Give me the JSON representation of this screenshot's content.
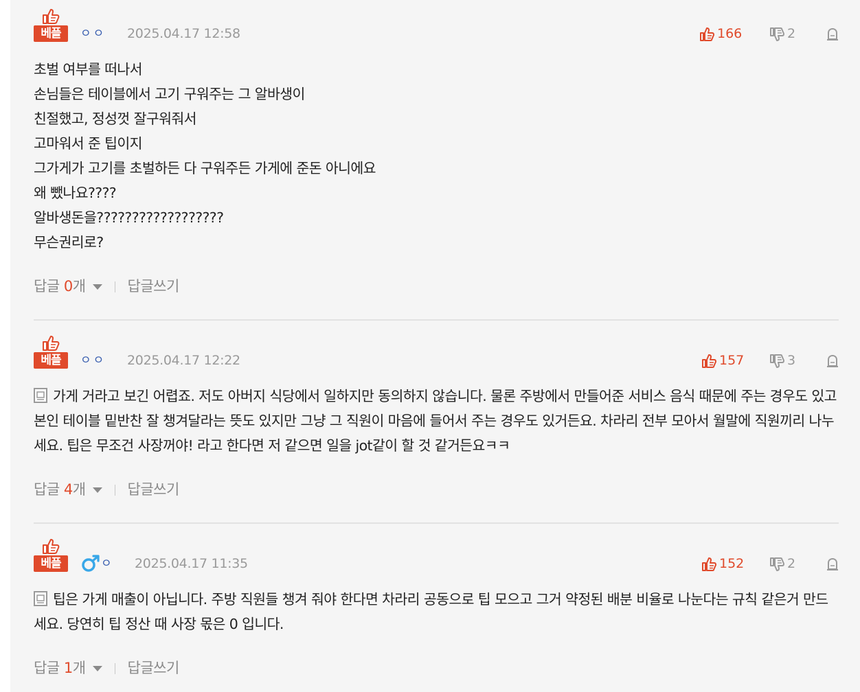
{
  "colors": {
    "accent": "#e04a2b",
    "muted": "#9a9a9a",
    "nick": "#3a5fb0",
    "panel": "#f5f5f5"
  },
  "labels": {
    "reply": "답글",
    "reply_unit": "개",
    "write_reply": "답글쓰기"
  },
  "comments": [
    {
      "badge": "베플",
      "nick": "ㅇㅇ",
      "gender_icon": "",
      "timestamp": "2025.04.17 12:58",
      "upvotes": "166",
      "downvotes": "2",
      "has_memo_icon": false,
      "text": "초벌 여부를 떠나서\n손님들은 테이블에서 고기 구워주는 그 알바생이\n친절했고, 정성껏 잘구워줘서\n고마워서 준 팁이지\n그가게가 고기를 초벌하든 다 구워주든 가게에 준돈 아니에요\n왜 뺐나요????\n알바생돈을??????????????????\n무슨권리로?",
      "reply_count": "0"
    },
    {
      "badge": "베플",
      "nick": "ㅇㅇ",
      "gender_icon": "",
      "timestamp": "2025.04.17 12:22",
      "upvotes": "157",
      "downvotes": "3",
      "has_memo_icon": true,
      "text": "가게 거라고 보긴 어렵죠. 저도 아버지 식당에서 일하지만 동의하지 않습니다. 물론 주방에서 만들어준 서비스 음식 때문에 주는 경우도 있고 본인 테이블 밑반찬 잘 챙겨달라는 뜻도 있지만 그냥 그 직원이 마음에 들어서 주는 경우도 있거든요. 차라리 전부 모아서 월말에 직원끼리 나누세요. 팁은 무조건 사장꺼야! 라고 한다면 저 같으면 일을 jot같이 할 것 같거든요ㅋㅋ",
      "reply_count": "4"
    },
    {
      "badge": "베플",
      "nick": "ㅇ",
      "gender_icon": "male-icon",
      "timestamp": "2025.04.17 11:35",
      "upvotes": "152",
      "downvotes": "2",
      "has_memo_icon": true,
      "text": "팁은 가게 매출이 아닙니다. 주방 직원들 챙겨 줘야 한다면 차라리 공동으로 팁 모으고 그거 약정된 배분 비율로 나눈다는 규칙 같은거 만드세요. 당연히 팁 정산 때 사장 몫은 0 입니다.",
      "reply_count": "1"
    }
  ]
}
